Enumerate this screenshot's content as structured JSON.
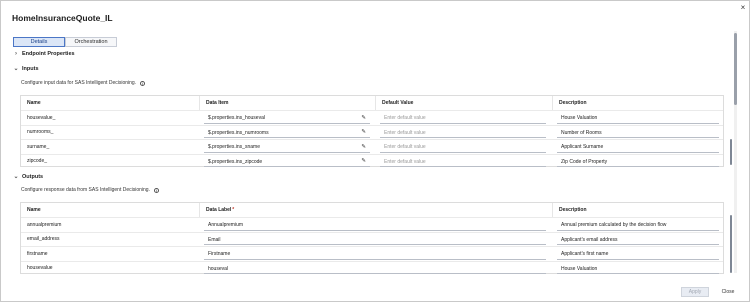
{
  "dialog": {
    "title": "HomeInsuranceQuote_IL",
    "close_symbol": "×"
  },
  "tabs": [
    {
      "label": "Details",
      "active": true
    },
    {
      "label": "Orchestration",
      "active": false
    }
  ],
  "endpoint_properties": {
    "label": "Endpoint Properties",
    "expanded": false
  },
  "inputs": {
    "label": "Inputs",
    "expanded": true,
    "description": "Configure input data for SAS Intelligent Decisioning.",
    "columns": {
      "name": "Name",
      "data_item": "Data Item",
      "default_value": "Default Value",
      "description": "Description"
    },
    "rows": [
      {
        "name": "housevalue_",
        "data_item": "$.properties.ins_houseval",
        "default_placeholder": "Enter default value",
        "description": "House Valuation"
      },
      {
        "name": "numrooms_",
        "data_item": "$.properties.ins_numrooms",
        "default_placeholder": "Enter default value",
        "description": "Number of Rooms"
      },
      {
        "name": "surname_",
        "data_item": "$.properties.ins_sname",
        "default_placeholder": "Enter default value",
        "description": "Applicant Surname"
      },
      {
        "name": "zipcode_",
        "data_item": "$.properties.ins_zipcode",
        "default_placeholder": "Enter default value",
        "description": "Zip Code of Property"
      }
    ]
  },
  "outputs": {
    "label": "Outputs",
    "expanded": true,
    "description": "Configure response data from SAS Intelligent Decisioning.",
    "columns": {
      "name": "Name",
      "data_label": "Data Label",
      "required_mark": "*",
      "description": "Description"
    },
    "rows": [
      {
        "name": "annualpremium",
        "data_label": "Annualpremium",
        "description": "Annual premium calculated by the decision flow"
      },
      {
        "name": "email_address",
        "data_label": "Email",
        "description": "Applicant's email address"
      },
      {
        "name": "firstname",
        "data_label": "Firstname",
        "description": "Applicant's first name"
      },
      {
        "name": "housevalue",
        "data_label": "houseval",
        "description": "House Valuation"
      }
    ]
  },
  "footer": {
    "apply_label": "Apply",
    "close_label": "Close"
  },
  "colors": {
    "accent": "#4b76c6",
    "active_tab_bg": "#dbe6f7",
    "required": "#c0392b"
  }
}
